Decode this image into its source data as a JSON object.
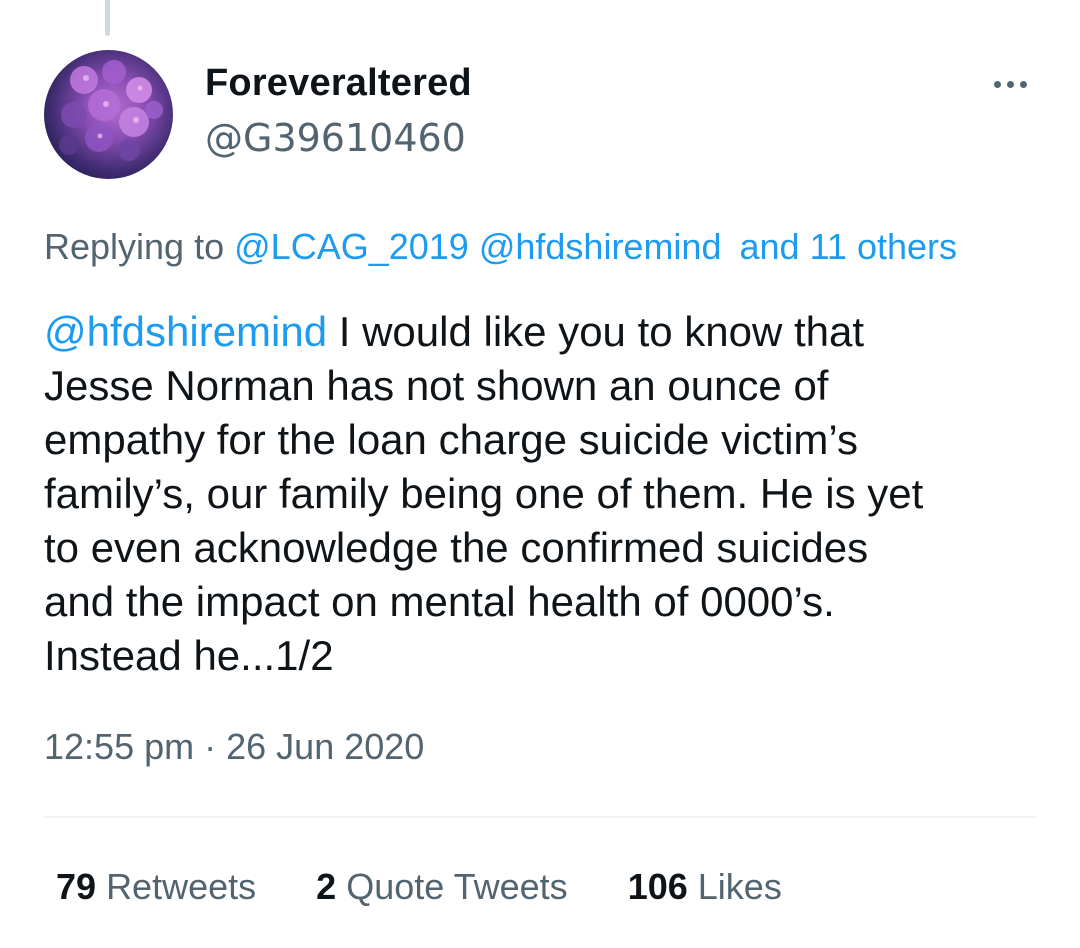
{
  "tweet": {
    "author": {
      "display_name": "Foreveraltered",
      "handle": "@G39610460",
      "avatar": "purple-hydrangea-flowers"
    },
    "more_icon": "more-horizontal-icon",
    "replying": {
      "prefix": "Replying to",
      "mention_1": "@LCAG_2019",
      "mention_2": "@hfdshiremind",
      "others": "and 11 others"
    },
    "body": {
      "mention": "@hfdshiremind",
      "line_1": " I would like you to know that",
      "line_2": "Jesse Norman has not shown an ounce of",
      "line_3": "empathy for the loan charge suicide victim’s",
      "line_4": "family’s, our family being one of them. He is yet",
      "line_5": "to even acknowledge the confirmed suicides",
      "line_6": "and the impact on mental health of 0000’s.",
      "line_7": "Instead he...1/2"
    },
    "timestamp": {
      "time": "12:55 pm",
      "separator": "·",
      "date": "26 Jun 2020"
    },
    "stats": {
      "retweets_count": "79",
      "retweets_label": "Retweets",
      "quotes_count": "2",
      "quotes_label": "Quote Tweets",
      "likes_count": "106",
      "likes_label": "Likes"
    }
  },
  "colors": {
    "link": "#1d9bf0",
    "secondary_text": "#536471",
    "primary_text": "#0f1419"
  }
}
